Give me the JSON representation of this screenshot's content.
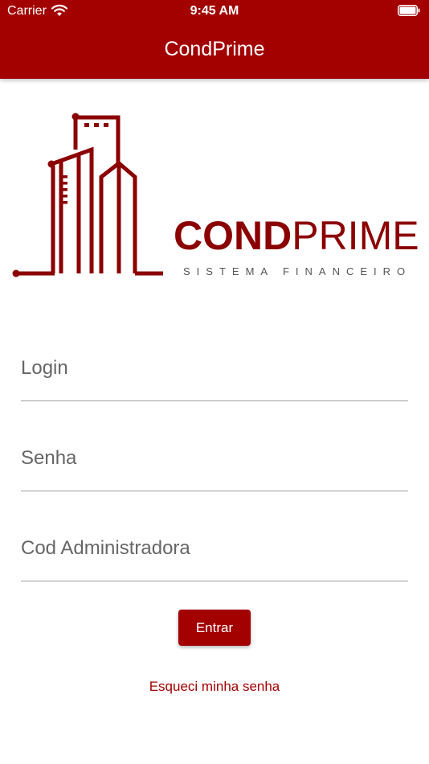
{
  "status_bar": {
    "carrier": "Carrier",
    "time": "9:45 AM"
  },
  "header": {
    "title": "CondPrime"
  },
  "logo": {
    "brand_bold": "COND",
    "brand_light": "PRIME",
    "tagline": "SISTEMA FINANCEIRO",
    "color": "#8b0000"
  },
  "form": {
    "login_placeholder": "Login",
    "password_placeholder": "Senha",
    "admin_code_placeholder": "Cod Administradora",
    "submit_label": "Entrar",
    "forgot_label": "Esqueci minha senha"
  },
  "colors": {
    "primary": "#a30000",
    "field_line": "#9e9e9e"
  }
}
